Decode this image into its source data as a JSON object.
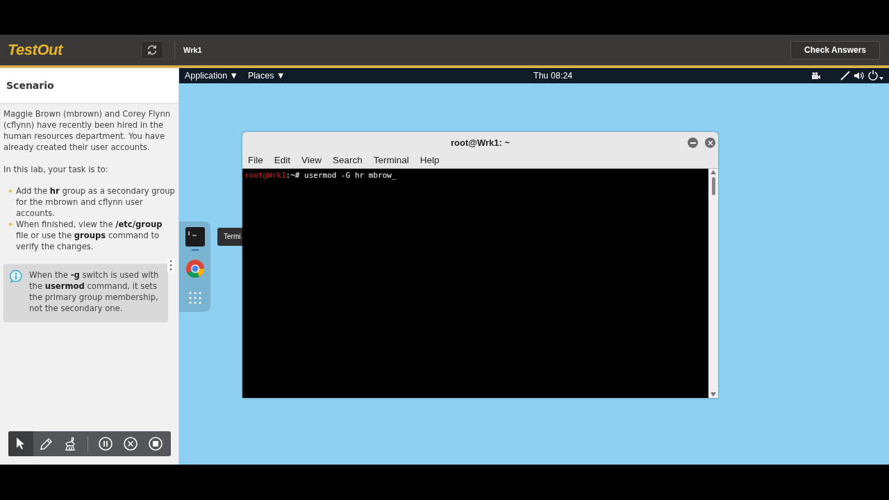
{
  "header": {
    "logo": "TestOut",
    "machine": "Wrk1",
    "check_button": "Check Answers"
  },
  "scenario": {
    "title": "Scenario",
    "intro": "Maggie Brown (mbrown) and Corey Flynn (cflynn) have recently been hired in the human resources department. You have already created their user accounts.",
    "task_lead": "In this lab, your task is to:",
    "tasks": [
      "Add the **hr** group as a secondary group for the mbrown and cflynn user accounts.",
      "When finished, view the **/etc/group** file or use the **groups** command to verify the changes."
    ],
    "hint": "When the **-g** switch is used with the **usermod** command, it sets the primary group membership, not the secondary one."
  },
  "tools": [
    {
      "kind": "pointer",
      "selected": true
    },
    {
      "kind": "pencil",
      "selected": false
    },
    {
      "kind": "brush",
      "selected": false
    },
    {
      "kind": "pause",
      "selected": false
    },
    {
      "kind": "cancel",
      "selected": false
    },
    {
      "kind": "stop",
      "selected": false
    }
  ],
  "desktop": {
    "menus": [
      "Application ▼",
      "Places ▼"
    ],
    "clock": "Thu 08:24",
    "dock": [
      {
        "kind": "terminal"
      },
      {
        "kind": "browser"
      },
      {
        "kind": "apps"
      }
    ],
    "tooltip": "Termi",
    "terminal": {
      "title": "root@Wrk1: ~",
      "menu": [
        "File",
        "Edit",
        "View",
        "Search",
        "Terminal",
        "Help"
      ],
      "prompt": "root@Wrk1",
      "command": ":~# usermod -G hr mbrow_"
    }
  }
}
